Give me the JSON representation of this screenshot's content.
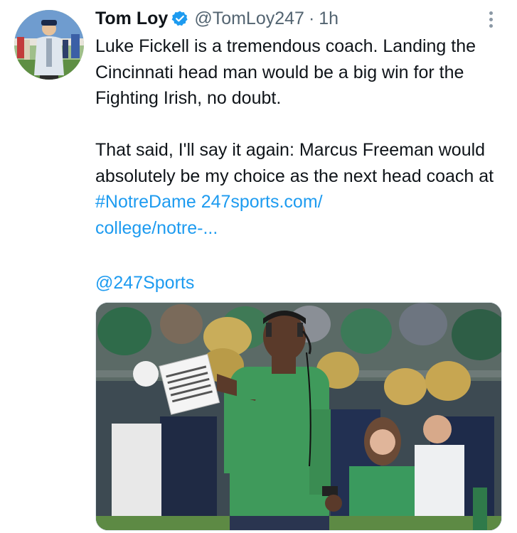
{
  "tweet": {
    "author_name": "Tom Loy",
    "handle": "@TomLoy247",
    "separator": "·",
    "time": "1h",
    "text": {
      "para1": "Luke Fickell is a tremendous coach. Landing the Cincinnati head man would be a big win for the Fighting Irish, no doubt.",
      "para2_prefix": "That said, I'll say it again: Marcus Freeman would absolutely be my choice as the next head coach at ",
      "hashtag": "#NotreDame",
      "url_part1": "247sports.com/",
      "url_part2": "college/notre-..."
    },
    "mention": "@247Sports",
    "icons": {
      "verified": "verified-badge-icon",
      "more": "more-options-icon"
    },
    "colors": {
      "link": "#1d9bf0",
      "secondary_text": "#536471",
      "verified_badge": "#1d9bf0"
    }
  }
}
